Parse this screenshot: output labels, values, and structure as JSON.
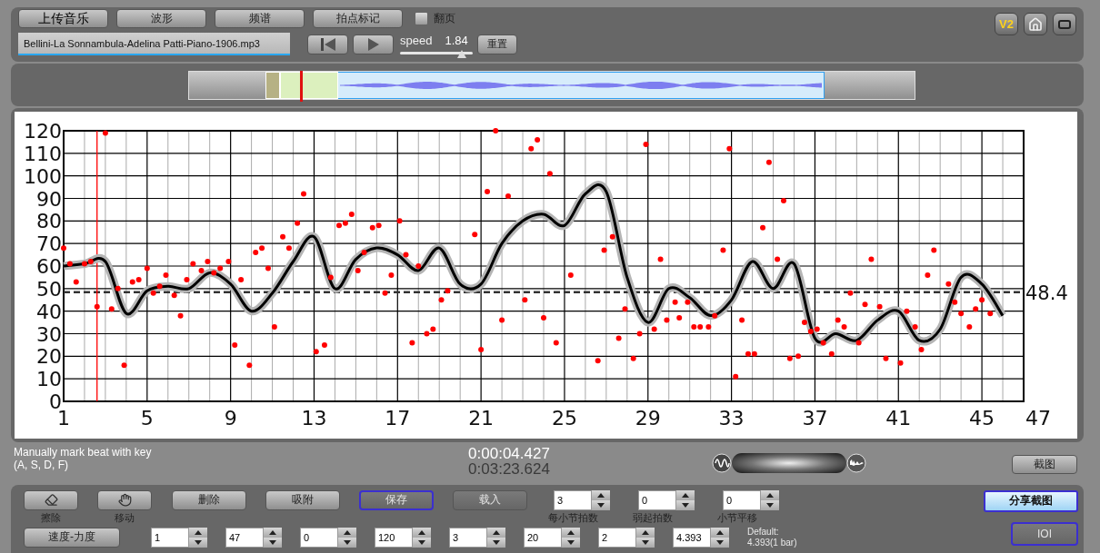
{
  "toolbar": {
    "buttons": [
      {
        "label": "上传音乐",
        "kind": "primary"
      },
      {
        "label": "波形",
        "kind": "plain"
      },
      {
        "label": "频谱",
        "kind": "plain"
      },
      {
        "label": "拍点标记",
        "kind": "plain"
      }
    ],
    "page_toggle": {
      "label": "翻页",
      "checked": false
    },
    "badge": "V2"
  },
  "file": {
    "value": "Bellini-La Sonnambula-Adelina Patti-Piano-1906.mp3"
  },
  "transport": {
    "speed_label": "speed",
    "speed_value": "1.84",
    "speed": {
      "level": 0.85
    },
    "reset_label": "重置"
  },
  "chart": {
    "chart_data": {
      "type": "line",
      "xlim": [
        1,
        47
      ],
      "ylim": [
        0,
        120
      ],
      "grid": true,
      "xticks": [
        1,
        5,
        9,
        13,
        17,
        21,
        25,
        29,
        33,
        37,
        41,
        45,
        47
      ],
      "yticks": [
        0,
        10,
        20,
        30,
        40,
        50,
        60,
        70,
        80,
        90,
        100,
        110,
        120
      ],
      "x": [
        1,
        2,
        3,
        4,
        5,
        6,
        7,
        8,
        9,
        10,
        11,
        12,
        13,
        14,
        15,
        16,
        17,
        18,
        19,
        20,
        21,
        22,
        23,
        24,
        25,
        26,
        27,
        28,
        29,
        30,
        31,
        32,
        33,
        34,
        35,
        36,
        37,
        38,
        39,
        40,
        41,
        42,
        43,
        44,
        45,
        46
      ],
      "series": [
        {
          "color": "#000000",
          "values": [
            60,
            61,
            62,
            39,
            49,
            51,
            50,
            57,
            52,
            40,
            48,
            62,
            73,
            50,
            63,
            68,
            65,
            58,
            68,
            52,
            52,
            70,
            80,
            83,
            78,
            92,
            93,
            55,
            35,
            50,
            46,
            38,
            45,
            62,
            50,
            61,
            28,
            30,
            27,
            36,
            40,
            27,
            32,
            55,
            52,
            38
          ]
        },
        {
          "type": "scatter",
          "marker": "o",
          "color": "#ff0000",
          "x": [
            1,
            1.3,
            1.6,
            2,
            2.3,
            2.6,
            3,
            3.3,
            3.6,
            3.9,
            4.3,
            4.6,
            5,
            5.3,
            5.6,
            5.9,
            6.3,
            6.6,
            6.9,
            7.2,
            7.6,
            7.9,
            8.2,
            8.5,
            8.9,
            9.2,
            9.5,
            9.9,
            10.2,
            10.5,
            10.8,
            11.1,
            11.5,
            11.8,
            12.2,
            12.5,
            13.1,
            13.5,
            13.8,
            14.2,
            14.5,
            14.8,
            15.1,
            15.4,
            15.8,
            16.1,
            16.4,
            16.7,
            17.1,
            17.4,
            17.7,
            18,
            18.4,
            18.7,
            19.1,
            19.4,
            20.7,
            21,
            21.3,
            21.7,
            22,
            22.3,
            23.1,
            23.4,
            23.7,
            24,
            24.3,
            24.6,
            25.3,
            26.6,
            26.9,
            27.3,
            27.6,
            27.9,
            28.3,
            28.6,
            28.9,
            29.3,
            29.6,
            29.9,
            30.3,
            30.5,
            30.9,
            31.2,
            31.5,
            31.9,
            32.2,
            32.6,
            32.9,
            33.2,
            33.5,
            33.8,
            34.1,
            34.5,
            34.8,
            35.2,
            35.5,
            35.8,
            36.2,
            36.5,
            36.8,
            37.1,
            37.4,
            37.8,
            38.1,
            38.4,
            38.7,
            39.1,
            39.4,
            39.7,
            40.1,
            40.4,
            41.1,
            41.4,
            41.8,
            42.1,
            42.4,
            42.7,
            43.4,
            43.7,
            44,
            44.4,
            44.7,
            45,
            45.4
          ],
          "values": [
            68,
            61,
            53,
            61,
            62,
            42,
            119,
            41,
            50,
            16,
            53,
            54,
            59,
            48,
            51,
            56,
            47,
            38,
            54,
            61,
            58,
            62,
            57,
            59,
            62,
            25,
            54,
            16,
            66,
            68,
            59,
            33,
            73,
            68,
            79,
            92,
            22,
            25,
            55,
            78,
            79,
            83,
            58,
            66,
            77,
            78,
            48,
            56,
            80,
            65,
            26,
            60,
            30,
            32,
            45,
            49,
            74,
            23,
            93,
            120,
            36,
            91,
            45,
            112,
            116,
            37,
            101,
            26,
            56,
            18,
            67,
            73,
            28,
            41,
            19,
            30,
            114,
            32,
            63,
            36,
            44,
            37,
            44,
            33,
            33,
            33,
            38,
            67,
            112,
            11,
            36,
            21,
            21,
            77,
            106,
            63,
            89,
            19,
            20,
            35,
            31,
            32,
            26,
            21,
            36,
            33,
            48,
            26,
            43,
            63,
            42,
            19,
            17,
            40,
            33,
            23,
            56,
            67,
            52,
            44,
            39,
            33,
            41,
            45,
            39
          ]
        }
      ],
      "ref_lines": [
        {
          "axis": "y",
          "value": 48.4,
          "label": "48.4"
        },
        {
          "axis": "x",
          "value": 2.6,
          "color": "#ff0000"
        }
      ]
    }
  },
  "status": {
    "hint": "Manually mark beat with key",
    "hint_keys": "(A, S, D, F)",
    "current_time": "0:00:04.427",
    "total_time": "0:03:23.624",
    "screenshot_button": "截图"
  },
  "tools": [
    {
      "label": "擦除"
    },
    {
      "label": "移动"
    }
  ],
  "actions": [
    {
      "label": "删除",
      "disabled": false,
      "focused": false
    },
    {
      "label": "吸附",
      "disabled": false,
      "focused": false
    },
    {
      "label": "保存",
      "disabled": true,
      "focused": true
    },
    {
      "label": "载入",
      "disabled": true,
      "focused": false
    }
  ],
  "meter_fields": [
    {
      "value": "3",
      "label": "每小节拍数"
    },
    {
      "value": "0",
      "label": "弱起拍数"
    },
    {
      "value": "0",
      "label": "小节平移"
    }
  ],
  "share_button": {
    "label": "分享截图",
    "active": true
  },
  "curve_button": {
    "label": "速度-力度"
  },
  "range_fields": [
    {
      "value": "1"
    },
    {
      "value": "47"
    },
    {
      "value": "0"
    },
    {
      "value": "120"
    },
    {
      "value": "3"
    },
    {
      "value": "20"
    },
    {
      "value": "2"
    },
    {
      "value": "4.393"
    }
  ],
  "default_note": [
    "Default:",
    "4.393(1 bar)"
  ],
  "ioi_button": {
    "label": "IOI",
    "disabled": true,
    "focused": true
  }
}
